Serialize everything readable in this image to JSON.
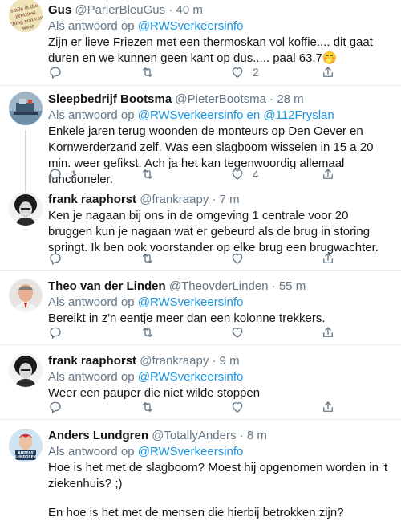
{
  "tweets": [
    {
      "name": "Gus",
      "handle": "@ParlerBleuGus",
      "time": "40 m",
      "reply_prefix": "Als antwoord op ",
      "reply_to": "@RWSverkeersinfo",
      "reply_extra": "",
      "text": "Zijn er lieve Friezen met een thermoskan vol koffie....  dit gaat duren en we kunnen geen kant op dus..... paal 63,7🤭",
      "replies": "",
      "retweets": "",
      "likes": "2"
    },
    {
      "name": "Sleepbedrijf Bootsma",
      "handle": "@PieterBootsma",
      "time": "28 m",
      "reply_prefix": "Als antwoord op ",
      "reply_to": "@RWSverkeersinfo en @112Fryslan",
      "reply_extra": "",
      "text": "Enkele jaren terug woonden de monteurs op Den Oever en Kornwerderzand zelf. Was een slagboom wisselen in 15 a 20 min. weer gefikst.  Ach ja het kan tegenwoordig allemaal functioneler.",
      "replies": "1",
      "retweets": "",
      "likes": "4"
    },
    {
      "name": "frank raaphorst",
      "handle": "@frankraapy",
      "time": "7 m",
      "text": "Ken je nagaan bij ons in de omgeving 1 centrale voor 20 bruggen kun je nagaan wat er gebeurd als de brug in storing springt. Ik ben ook voorstander op elke brug een brugwachter.",
      "replies": "",
      "retweets": "",
      "likes": ""
    },
    {
      "name": "Theo van der Linden",
      "handle": "@TheovderLinden",
      "time": "55 m",
      "reply_prefix": "Als antwoord op ",
      "reply_to": "@RWSverkeersinfo",
      "text": "Bereikt in z'n eentje meer dan een kolonne trekkers.",
      "replies": "",
      "retweets": "",
      "likes": ""
    },
    {
      "name": "frank raaphorst",
      "handle": "@frankraapy",
      "time": "9 m",
      "reply_prefix": "Als antwoord op ",
      "reply_to": "@RWSverkeersinfo",
      "text": "Weer een pauper die niet wilde stoppen",
      "replies": "",
      "retweets": "",
      "likes": ""
    },
    {
      "name": "Anders Lundgren",
      "handle": "@TotallyAnders",
      "time": "8 m",
      "reply_prefix": "Als antwoord op ",
      "reply_to": "@RWSverkeersinfo",
      "text": "Hoe is het met de slagboom? Moest hij opgenomen worden in 't ziekenhuis? ;)",
      "text2": "En hoe is het met de mensen die hierbij betrokken zijn?"
    }
  ],
  "avatar_texts": {
    "gus": "smile is the prettiest thing you can wear",
    "anders": "ANDERS LUNDGREN"
  },
  "icons": {
    "reply": "reply-icon",
    "retweet": "retweet-icon",
    "like": "heart-icon",
    "share": "share-icon"
  },
  "colors": {
    "link": "#1b95e0",
    "muted": "#657786",
    "divider": "#e6ecf0"
  }
}
